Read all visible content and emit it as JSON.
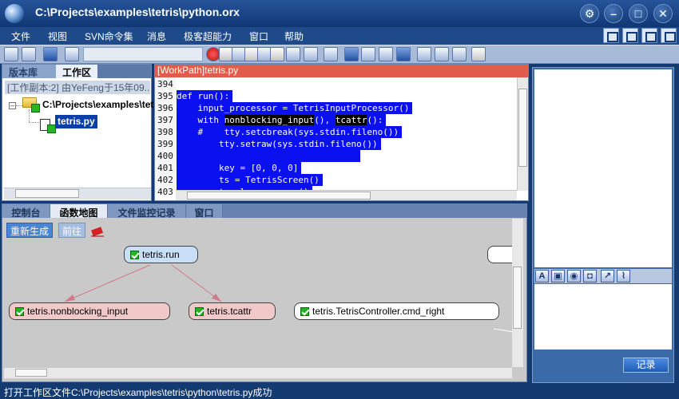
{
  "window": {
    "title": "C:\\Projects\\examples\\tetris\\python.orx",
    "controls": [
      "settings-icon",
      "minimize-icon",
      "maximize-icon",
      "close-icon"
    ]
  },
  "menu": {
    "items": [
      "文件",
      "视图",
      "SVN命令集",
      "消息",
      "极客超能力",
      "窗口",
      "帮助"
    ]
  },
  "left_panel": {
    "tabs": [
      "版本库",
      "工作区"
    ],
    "working_copy_info": "[工作副本:2] 由YeFeng于15年09...",
    "tree_root": "C:\\Projects\\examples\\tetr",
    "tree_file": "tetris.py"
  },
  "editor": {
    "tab_title": "[WorkPath]tetris.py",
    "lines": [
      {
        "num": "394",
        "text": ""
      },
      {
        "num": "395",
        "text": "def run():"
      },
      {
        "num": "396",
        "text": "    input_processor = TetrisInputProcessor()"
      },
      {
        "num": "397",
        "text": "    with nonblocking_input(), tcattr():"
      },
      {
        "num": "398",
        "text": "    #    tty.setcbreak(sys.stdin.fileno())"
      },
      {
        "num": "399",
        "text": "        tty.setraw(sys.stdin.fileno())"
      },
      {
        "num": "400",
        "text": ""
      },
      {
        "num": "401",
        "text": "        key = [0, 0, 0]"
      },
      {
        "num": "402",
        "text": "        ts = TetrisScreen()"
      },
      {
        "num": "403",
        "text": "        ts.clear_screen()"
      }
    ]
  },
  "bottom_panel": {
    "tabs": [
      "控制台",
      "函数地图",
      "文件监控记录",
      "窗口"
    ],
    "active_tab": "函数地图",
    "regen_label": "重新生成",
    "forward_label": "前往",
    "nodes": {
      "run": "tetris.run",
      "nonblocking": "tetris.nonblocking_input",
      "tcattr": "tetris.tcattr",
      "cmd_right": "tetris.TetrisController.cmd_right"
    }
  },
  "right_panel": {
    "toolbar_icons": [
      "text-icon",
      "image-icon",
      "camera-icon",
      "capture-icon",
      "pen-icon",
      "attach-icon"
    ],
    "record_label": "记录"
  },
  "status": {
    "message": "打开工作区文件C:\\Projects\\examples\\tetris\\python\\tetris.py成功"
  },
  "colors": {
    "accent": "#0a10f0",
    "editor_tab": "#e25b4c",
    "node_run": "#c9def7",
    "node_call": "#f2c9c9"
  }
}
